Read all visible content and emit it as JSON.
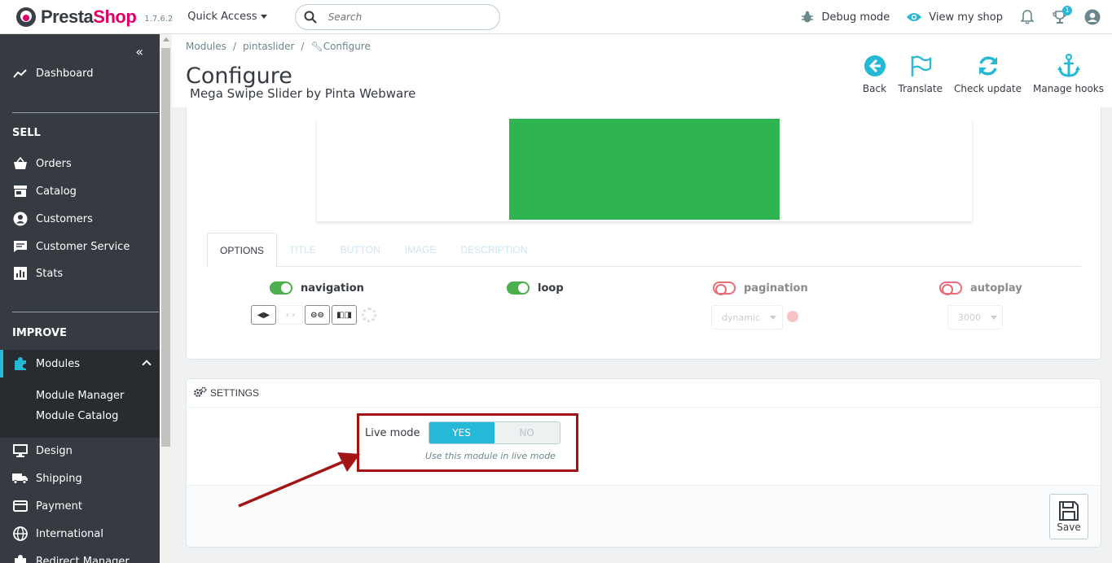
{
  "header": {
    "brand_presta": "Presta",
    "brand_shop": "Shop",
    "version": "1.7.6.2",
    "quick_access": "Quick Access",
    "search_placeholder": "Search",
    "debug_mode": "Debug mode",
    "view_shop": "View my shop",
    "trophy_badge": "1"
  },
  "sidebar": {
    "dashboard": "Dashboard",
    "sell_title": "SELL",
    "orders": "Orders",
    "catalog": "Catalog",
    "customers": "Customers",
    "customer_service": "Customer Service",
    "stats": "Stats",
    "improve_title": "IMPROVE",
    "modules": "Modules",
    "module_manager": "Module Manager",
    "module_catalog": "Module Catalog",
    "design": "Design",
    "shipping": "Shipping",
    "payment": "Payment",
    "international": "International",
    "redirect_manager": "Redirect Manager"
  },
  "breadcrumb": {
    "modules": "Modules",
    "sep": "/",
    "pintaslider": "pintaslider",
    "configure": "Configure"
  },
  "page": {
    "title": "Configure",
    "subtitle": "Mega Swipe Slider by Pinta Webware"
  },
  "toolbar": {
    "back": "Back",
    "translate": "Translate",
    "check_update": "Check update",
    "manage_hooks": "Manage hooks"
  },
  "tabs": [
    "OPTIONS",
    "TITLE",
    "BUTTON",
    "IMAGE",
    "DESCRIPTION"
  ],
  "options": {
    "navigation": "navigation",
    "loop": "loop",
    "pagination": "pagination",
    "autoplay": "autoplay",
    "pagination_select": "dynamic",
    "autoplay_select": "3000"
  },
  "settings": {
    "title": "SETTINGS",
    "live_mode_label": "Live mode",
    "yes": "YES",
    "no": "NO",
    "help": "Use this module in live mode",
    "save": "Save"
  },
  "colors": {
    "accent": "#25b9d7",
    "sidebar": "#363a41",
    "highlight": "#a31515",
    "slide_green": "#2eb552"
  }
}
